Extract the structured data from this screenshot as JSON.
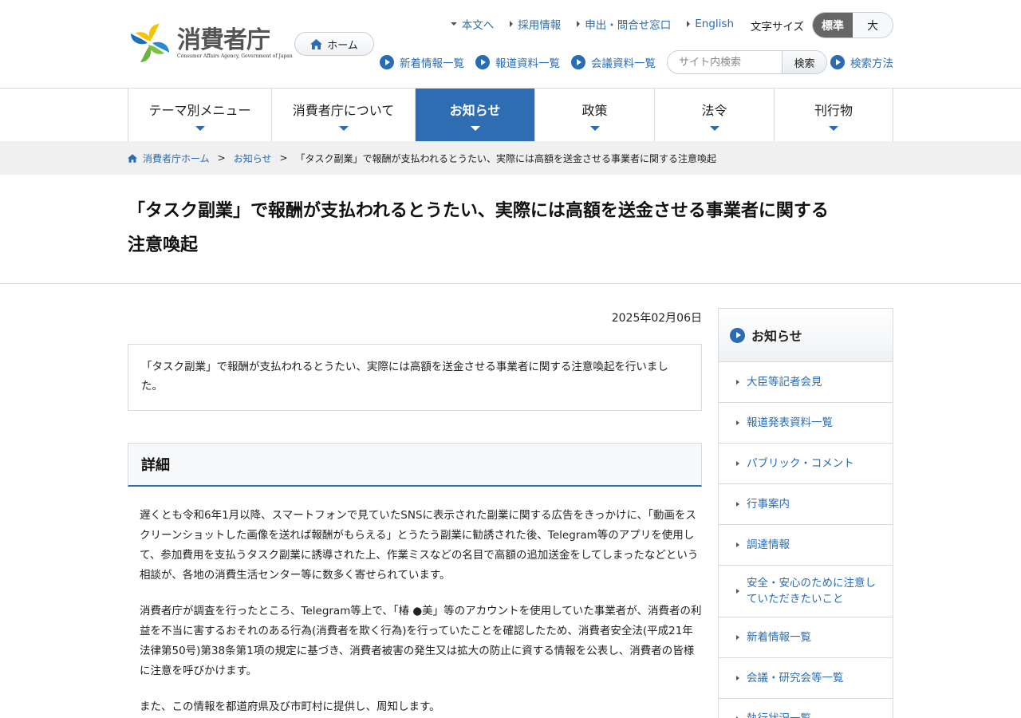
{
  "header": {
    "logo_title": "消費者庁",
    "logo_subtitle": "Consumer Affairs Agency, Government of Japan",
    "home_label": "ホーム",
    "top_links": [
      "本文へ",
      "採用情報",
      "申出・問合せ窓口",
      "English"
    ],
    "font_size_label": "文字サイズ",
    "font_size_options": [
      "標準",
      "大"
    ],
    "quick_links": [
      "新着情報一覧",
      "報道資料一覧",
      "会議資料一覧"
    ],
    "search_placeholder": "サイト内検索",
    "search_button": "検索",
    "search_help": "検索方法"
  },
  "global_nav": [
    "テーマ別メニュー",
    "消費者庁について",
    "お知らせ",
    "政策",
    "法令",
    "刊行物"
  ],
  "breadcrumb": {
    "home": "消費者庁ホーム",
    "parent": "お知らせ",
    "current": "「タスク副業」で報酬が支払われるとうたい、実際には高額を送金させる事業者に関する注意喚起"
  },
  "page": {
    "title_line1": "「タスク副業」で報酬が支払われるとうたい、実際には高額を送金させる事業者に関する",
    "title_line2": "注意喚起",
    "date": "2025年02月06日",
    "summary": "「タスク副業」で報酬が支払われるとうたい、実際には高額を送金させる事業者に関する注意喚起を行いました。",
    "section_heading": "詳細",
    "paragraphs": [
      "遅くとも令和6年1月以降、スマートフォンで見ていたSNSに表示された副業に関する広告をきっかけに、「動画をスクリーンショットした画像を送れば報酬がもらえる」とうたう副業に勧誘された後、Telegram等のアプリを使用して、参加費用を支払うタスク副業に誘導された上、作業ミスなどの名目で高額の追加送金をしてしまったなどという相談が、各地の消費生活センター等に数多く寄せられています。",
      "消費者庁が調査を行ったところ、Telegram等上で、「椿 ●美」等のアカウントを使用していた事業者が、消費者の利益を不当に害するおそれのある行為(消費者を欺く行為)を行っていたことを確認したため、消費者安全法(平成21年法律第50号)第38条第1項の規定に基づき、消費者被害の発生又は拡大の防止に資する情報を公表し、消費者の皆様に注意を呼びかけます。",
      "また、この情報を都道府県及び市町村に提供し、周知します。"
    ]
  },
  "sidebar": {
    "heading": "お知らせ",
    "items": [
      "大臣等記者会見",
      "報道発表資料一覧",
      "パブリック・コメント",
      "行事案内",
      "調達情報",
      "安全・安心のために注意していただきたいこと",
      "新着情報一覧",
      "会議・研究会等一覧",
      "執行状況一覧"
    ]
  },
  "colors": {
    "accent": "#2f6db3",
    "link": "#2a6cb3",
    "breadcrumb_bg": "#f0f0f0"
  }
}
